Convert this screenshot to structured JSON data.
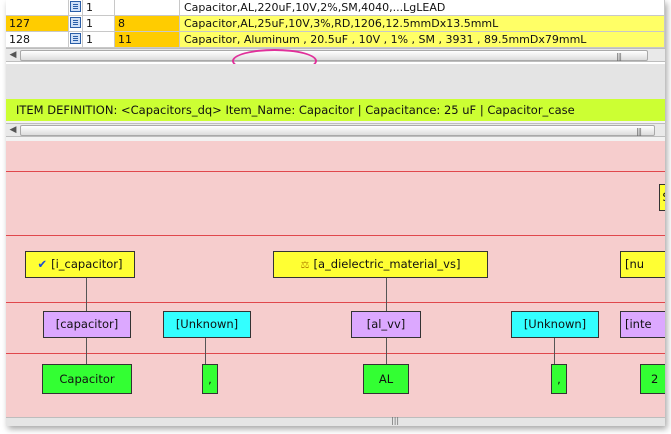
{
  "grid": {
    "rows": [
      {
        "id": "",
        "qty": "1",
        "row": "",
        "desc": "Capacitor,AL,220uF,10V,2%,SM,4040,...LgLEAD"
      },
      {
        "id": "127",
        "qty": "1",
        "row": "8",
        "desc": "Capacitor,AL,25uF,10V,3%,RD,1206,12.5mmDx13.5mmL"
      },
      {
        "id": "128",
        "qty": "1",
        "row": "11",
        "desc_parts": [
          "Capacitor",
          ", Aluminum , 20.5uF , 10V , 1% , SM , 3931 , 89.5mmDx79mmL"
        ]
      }
    ],
    "icon": "document-icon"
  },
  "definition_bar": {
    "text": "ITEM DEFINITION: <Capacitors_dq>  Item_Name: Capacitor | Capacitance: 25 uF | Capacitor_case"
  },
  "tree": {
    "level1": [
      {
        "label": "[i_capacitor]",
        "icon": "checkmark-icon"
      },
      {
        "label": "[a_dielectric_material_vs]",
        "icon": "scale-icon"
      },
      {
        "label": "[nu"
      }
    ],
    "level2": [
      {
        "label": "[capacitor]"
      },
      {
        "label": "[Unknown]"
      },
      {
        "label": "[al_vv]"
      },
      {
        "label": "[Unknown]"
      },
      {
        "label": "[inte"
      }
    ],
    "level3": [
      {
        "label": "Capacitor"
      },
      {
        "label": ","
      },
      {
        "label": "AL"
      },
      {
        "label": ","
      },
      {
        "label": "2"
      }
    ],
    "top_right_stub": "S"
  },
  "scrollbar": {
    "grip": "|||"
  },
  "colors": {
    "orange": "#ffcc00",
    "yellow": "#ffff66",
    "lime": "#ccff33",
    "pink_panel": "#f6cdcd",
    "purple_node": "#dca8ff",
    "cyan_node": "#33ffff",
    "green_node": "#33ff33",
    "highlight_ellipse": "#e0309a"
  }
}
